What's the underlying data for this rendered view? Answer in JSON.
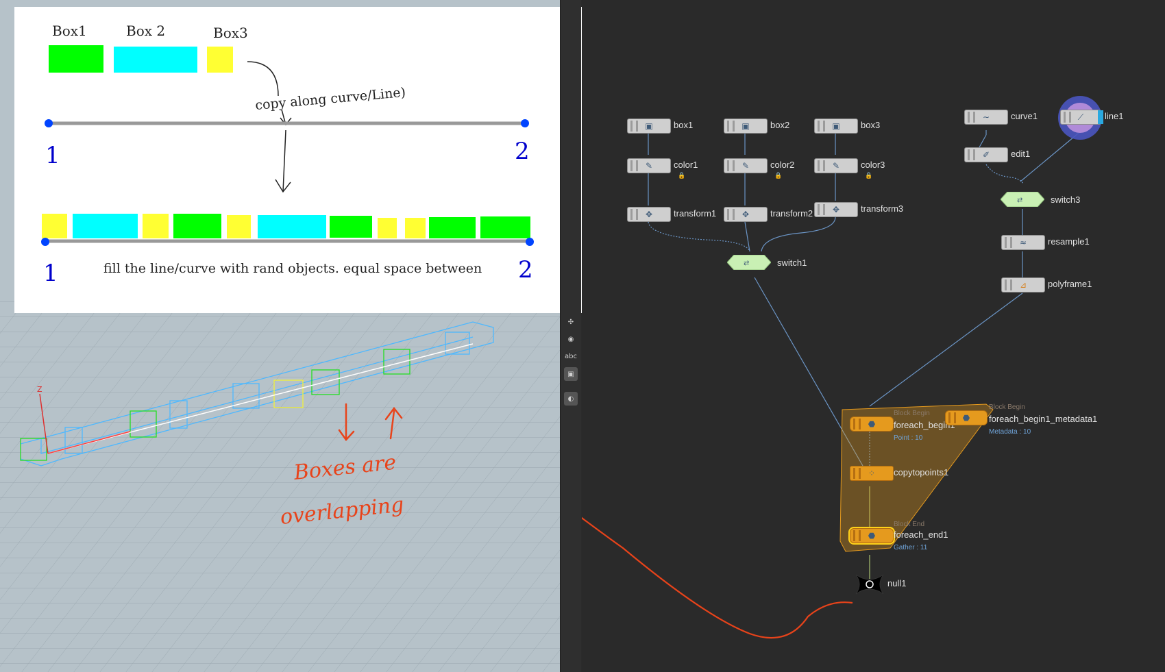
{
  "sketch": {
    "box_labels": [
      "Box1",
      "Box 2",
      "Box3"
    ],
    "copy_note": "copy along curve/Line)",
    "point_start": "1",
    "point_end": "2",
    "fill_note": "fill the line/curve with rand objects. equal space between"
  },
  "viewport": {
    "annotation_line1": "Boxes are",
    "annotation_line2": "overlapping",
    "axis_label": "Z"
  },
  "toolstrip": {
    "text_tool": "abc"
  },
  "colors": {
    "green_box": "#00ff00",
    "cyan_box": "#00ffff",
    "yellow_box": "#ffff33",
    "annotation": "#e8431a",
    "node_label": "#e2e2e2",
    "block_label": "#6fa3d8",
    "block_tint": "#e59a1e"
  },
  "network": {
    "nodes": {
      "box1": "box1",
      "box2": "box2",
      "box3": "box3",
      "color1": "color1",
      "color2": "color2",
      "color3": "color3",
      "transform1": "transform1",
      "transform2": "transform2",
      "transform3": "transform3",
      "switch1": "switch1",
      "curve1": "curve1",
      "line1": "line1",
      "edit1": "edit1",
      "switch3": "switch3",
      "resample1": "resample1",
      "polyframe1": "polyframe1",
      "foreach_begin1": "foreach_begin1",
      "foreach_begin1_metadata1": "foreach_begin1_metadata1",
      "copytopoints1": "copytopoints1",
      "foreach_end1": "foreach_end1",
      "null1": "null1"
    },
    "tags": {
      "block_begin": "Block Begin",
      "block_begin_meta": "Block Begin",
      "block_end": "Block End"
    },
    "subs": {
      "begin_points": "Point : 10",
      "meta_count": "Metadata : 10",
      "end_gather": "Gather : 11"
    }
  }
}
